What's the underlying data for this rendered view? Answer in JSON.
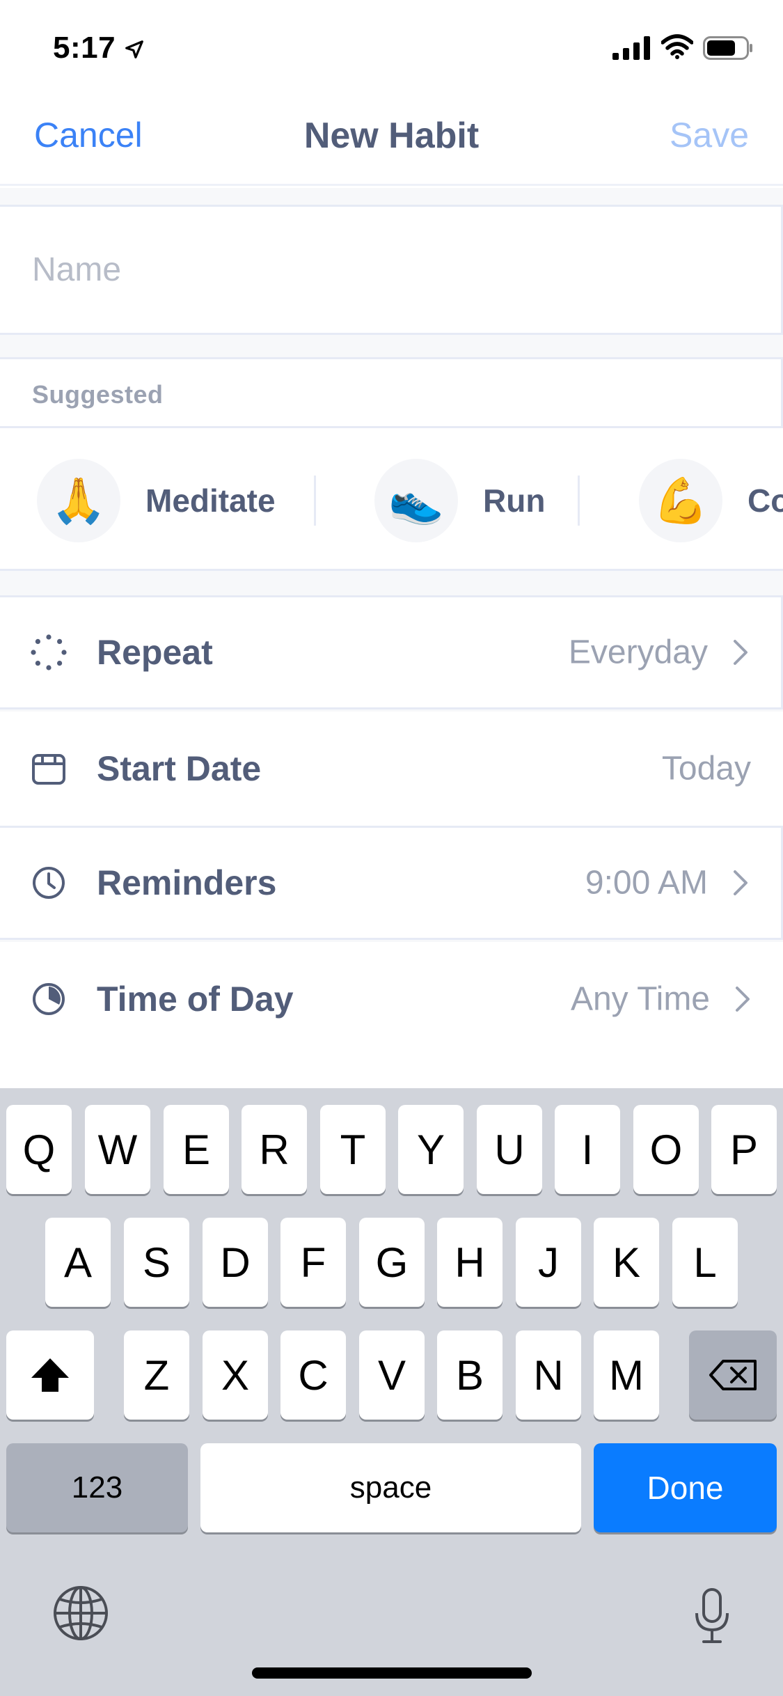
{
  "status_bar": {
    "time": "5:17"
  },
  "nav": {
    "cancel_label": "Cancel",
    "title": "New Habit",
    "save_label": "Save"
  },
  "name_field": {
    "placeholder": "Name",
    "value": ""
  },
  "suggested": {
    "header": "Suggested",
    "items": [
      {
        "emoji": "🙏",
        "label": "Meditate"
      },
      {
        "emoji": "👟",
        "label": "Run"
      },
      {
        "emoji": "💪",
        "label": "Co"
      }
    ]
  },
  "settings": [
    {
      "icon": "repeat-icon",
      "label": "Repeat",
      "value": "Everyday",
      "chevron": true
    },
    {
      "icon": "calendar-icon",
      "label": "Start Date",
      "value": "Today",
      "chevron": false
    },
    {
      "icon": "clock-icon",
      "label": "Reminders",
      "value": "9:00 AM",
      "chevron": true
    },
    {
      "icon": "time-of-day-icon",
      "label": "Time of Day",
      "value": "Any Time",
      "chevron": true
    }
  ],
  "keyboard": {
    "row1": [
      "Q",
      "W",
      "E",
      "R",
      "T",
      "Y",
      "U",
      "I",
      "O",
      "P"
    ],
    "row2": [
      "A",
      "S",
      "D",
      "F",
      "G",
      "H",
      "J",
      "K",
      "L"
    ],
    "row3": [
      "Z",
      "X",
      "C",
      "V",
      "B",
      "N",
      "M"
    ],
    "numbers_label": "123",
    "space_label": "space",
    "done_label": "Done"
  },
  "colors": {
    "accent": "#3b82f6",
    "save_disabled": "#a5c4f7",
    "done_key": "#0a7cff",
    "text": "#525d79",
    "muted": "#9ba2b2"
  }
}
